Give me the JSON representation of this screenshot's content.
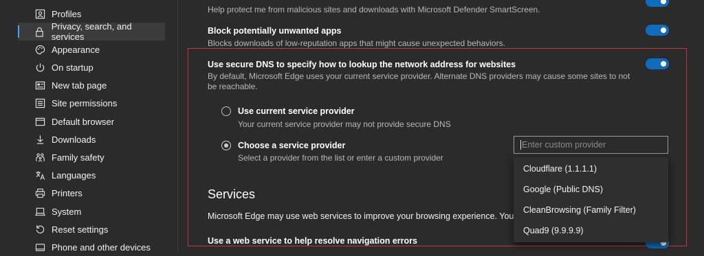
{
  "sidebar": {
    "items": [
      {
        "label": "Profiles",
        "icon": "profile-icon"
      },
      {
        "label": "Privacy, search, and services",
        "icon": "lock-icon",
        "selected": true
      },
      {
        "label": "Appearance",
        "icon": "palette-icon"
      },
      {
        "label": "On startup",
        "icon": "power-icon"
      },
      {
        "label": "New tab page",
        "icon": "newtab-icon"
      },
      {
        "label": "Site permissions",
        "icon": "permissions-icon"
      },
      {
        "label": "Default browser",
        "icon": "browser-icon"
      },
      {
        "label": "Downloads",
        "icon": "download-icon"
      },
      {
        "label": "Family safety",
        "icon": "family-icon"
      },
      {
        "label": "Languages",
        "icon": "languages-icon"
      },
      {
        "label": "Printers",
        "icon": "printer-icon"
      },
      {
        "label": "System",
        "icon": "system-icon"
      },
      {
        "label": "Reset settings",
        "icon": "reset-icon"
      },
      {
        "label": "Phone and other devices",
        "icon": "phone-icon"
      }
    ]
  },
  "main": {
    "smartscreen_desc": "Help protect me from malicious sites and downloads with Microsoft Defender SmartScreen.",
    "pua_title": "Block potentially unwanted apps",
    "pua_desc": "Blocks downloads of low-reputation apps that might cause unexpected behaviors.",
    "dns_title": "Use secure DNS to specify how to lookup the network address for websites",
    "dns_desc_line1": "By default, Microsoft Edge uses your current service provider. Alternate DNS providers may cause some sites to not",
    "dns_desc_line2": "be reachable.",
    "option_current_title": "Use current service provider",
    "option_current_desc": "Your current service provider may not provide secure DNS",
    "option_choose_title": "Choose a service provider",
    "option_choose_desc": "Select a provider from the list or enter a custom provider",
    "custom_provider_placeholder": "Enter custom provider",
    "providers": [
      "Cloudflare (1.1.1.1)",
      "Google (Public DNS)",
      "CleanBrowsing (Family Filter)",
      "Quad9 (9.9.9.9)"
    ],
    "services_heading": "Services",
    "services_desc": "Microsoft Edge may use web services to improve your browsing experience. You ca",
    "nav_errors_title": "Use a web service to help resolve navigation errors"
  },
  "colors": {
    "accent": "#0f6cbd",
    "highlight_border": "#d13438",
    "background": "#2b2b2b"
  }
}
